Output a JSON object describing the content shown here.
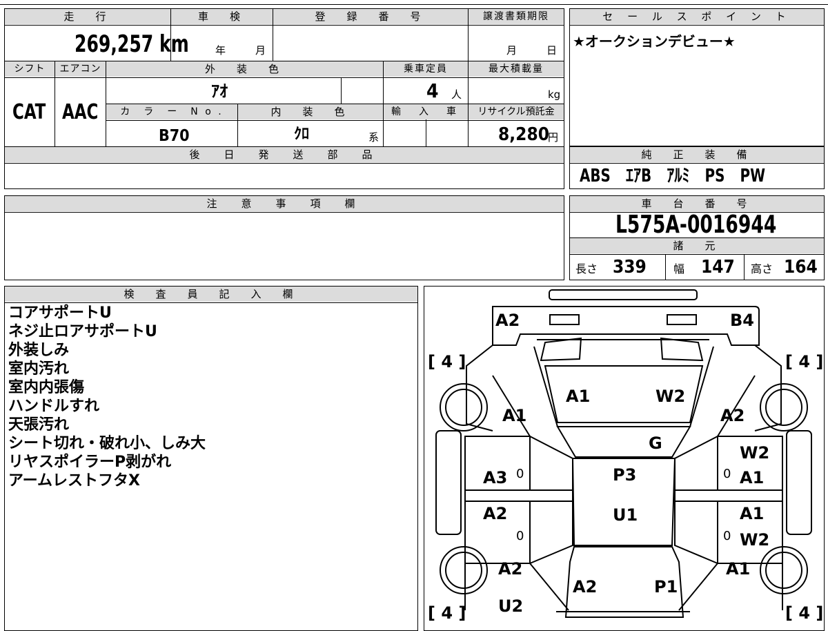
{
  "top": {
    "mileage": {
      "label": "走　行",
      "value": "269,257 km"
    },
    "inspection": {
      "label": "車　検",
      "year": "年",
      "month": "月"
    },
    "registration": {
      "label": "登　録　番　号"
    },
    "transfer": {
      "label": "譲渡書類期限",
      "month": "月",
      "day": "日"
    },
    "shift": {
      "label": "シフト",
      "value": "CAT"
    },
    "aircon": {
      "label": "エアコン",
      "value": "AAC"
    },
    "exterior": {
      "label": "外　装　色",
      "value": "ｱｵ"
    },
    "capacity": {
      "label": "乗車定員",
      "value": "4",
      "unit": "人"
    },
    "load": {
      "label": "最大積載量",
      "unit": "kg"
    },
    "color_no": {
      "label": "カ　ラ　ー　N o .",
      "value": "B70"
    },
    "interior": {
      "label": "内　装　色",
      "value": "ｸﾛ",
      "suffix": "系"
    },
    "import": {
      "label": "輸　入　車"
    },
    "recycle": {
      "label": "リサイクル預託金",
      "value": "8,280",
      "unit": "円"
    },
    "later_parts": {
      "label": "後　日　発　送　部　品"
    }
  },
  "sales": {
    "label": "セ ー ル ス ポ イ ン ト",
    "text": "★オークションデビュー★"
  },
  "equipment": {
    "label": "純　正　装　備",
    "items": "ABS　ｴｱB　ｱﾙﾐ　PS　PW"
  },
  "notes": {
    "label": "注　意　事　項　欄"
  },
  "chassis": {
    "label": "車　台　番　号",
    "value": "L575A-0016944"
  },
  "specs": {
    "label": "諸　元",
    "length_label": "長さ",
    "length": "339",
    "width_label": "幅",
    "width": "147",
    "height_label": "高さ",
    "height": "164"
  },
  "inspector": {
    "label": "検　査　員　記　入　欄",
    "lines": [
      "コアサポートU",
      "ネジ止ロアサポートU",
      "外装しみ",
      "室内汚れ",
      "室内内張傷",
      "ハンドルすれ",
      "天張汚れ",
      "シート切れ・破れ小、しみ大",
      "リヤスポイラーP剥がれ",
      "アームレストフタX"
    ]
  },
  "diagram": {
    "tires": [
      "[ 4 ]",
      "[ 4 ]",
      "[ 4 ]",
      "[ 4 ]"
    ],
    "codes": [
      "A2",
      "B4",
      "A1",
      "W2",
      "A1",
      "A2",
      "G",
      "W2",
      "A3",
      "P3",
      "A1",
      "A2",
      "U1",
      "A1",
      "W2",
      "A2",
      "A1",
      "A2",
      "P1",
      "U2"
    ],
    "zeros": [
      "0",
      "0",
      "0",
      "0"
    ]
  }
}
